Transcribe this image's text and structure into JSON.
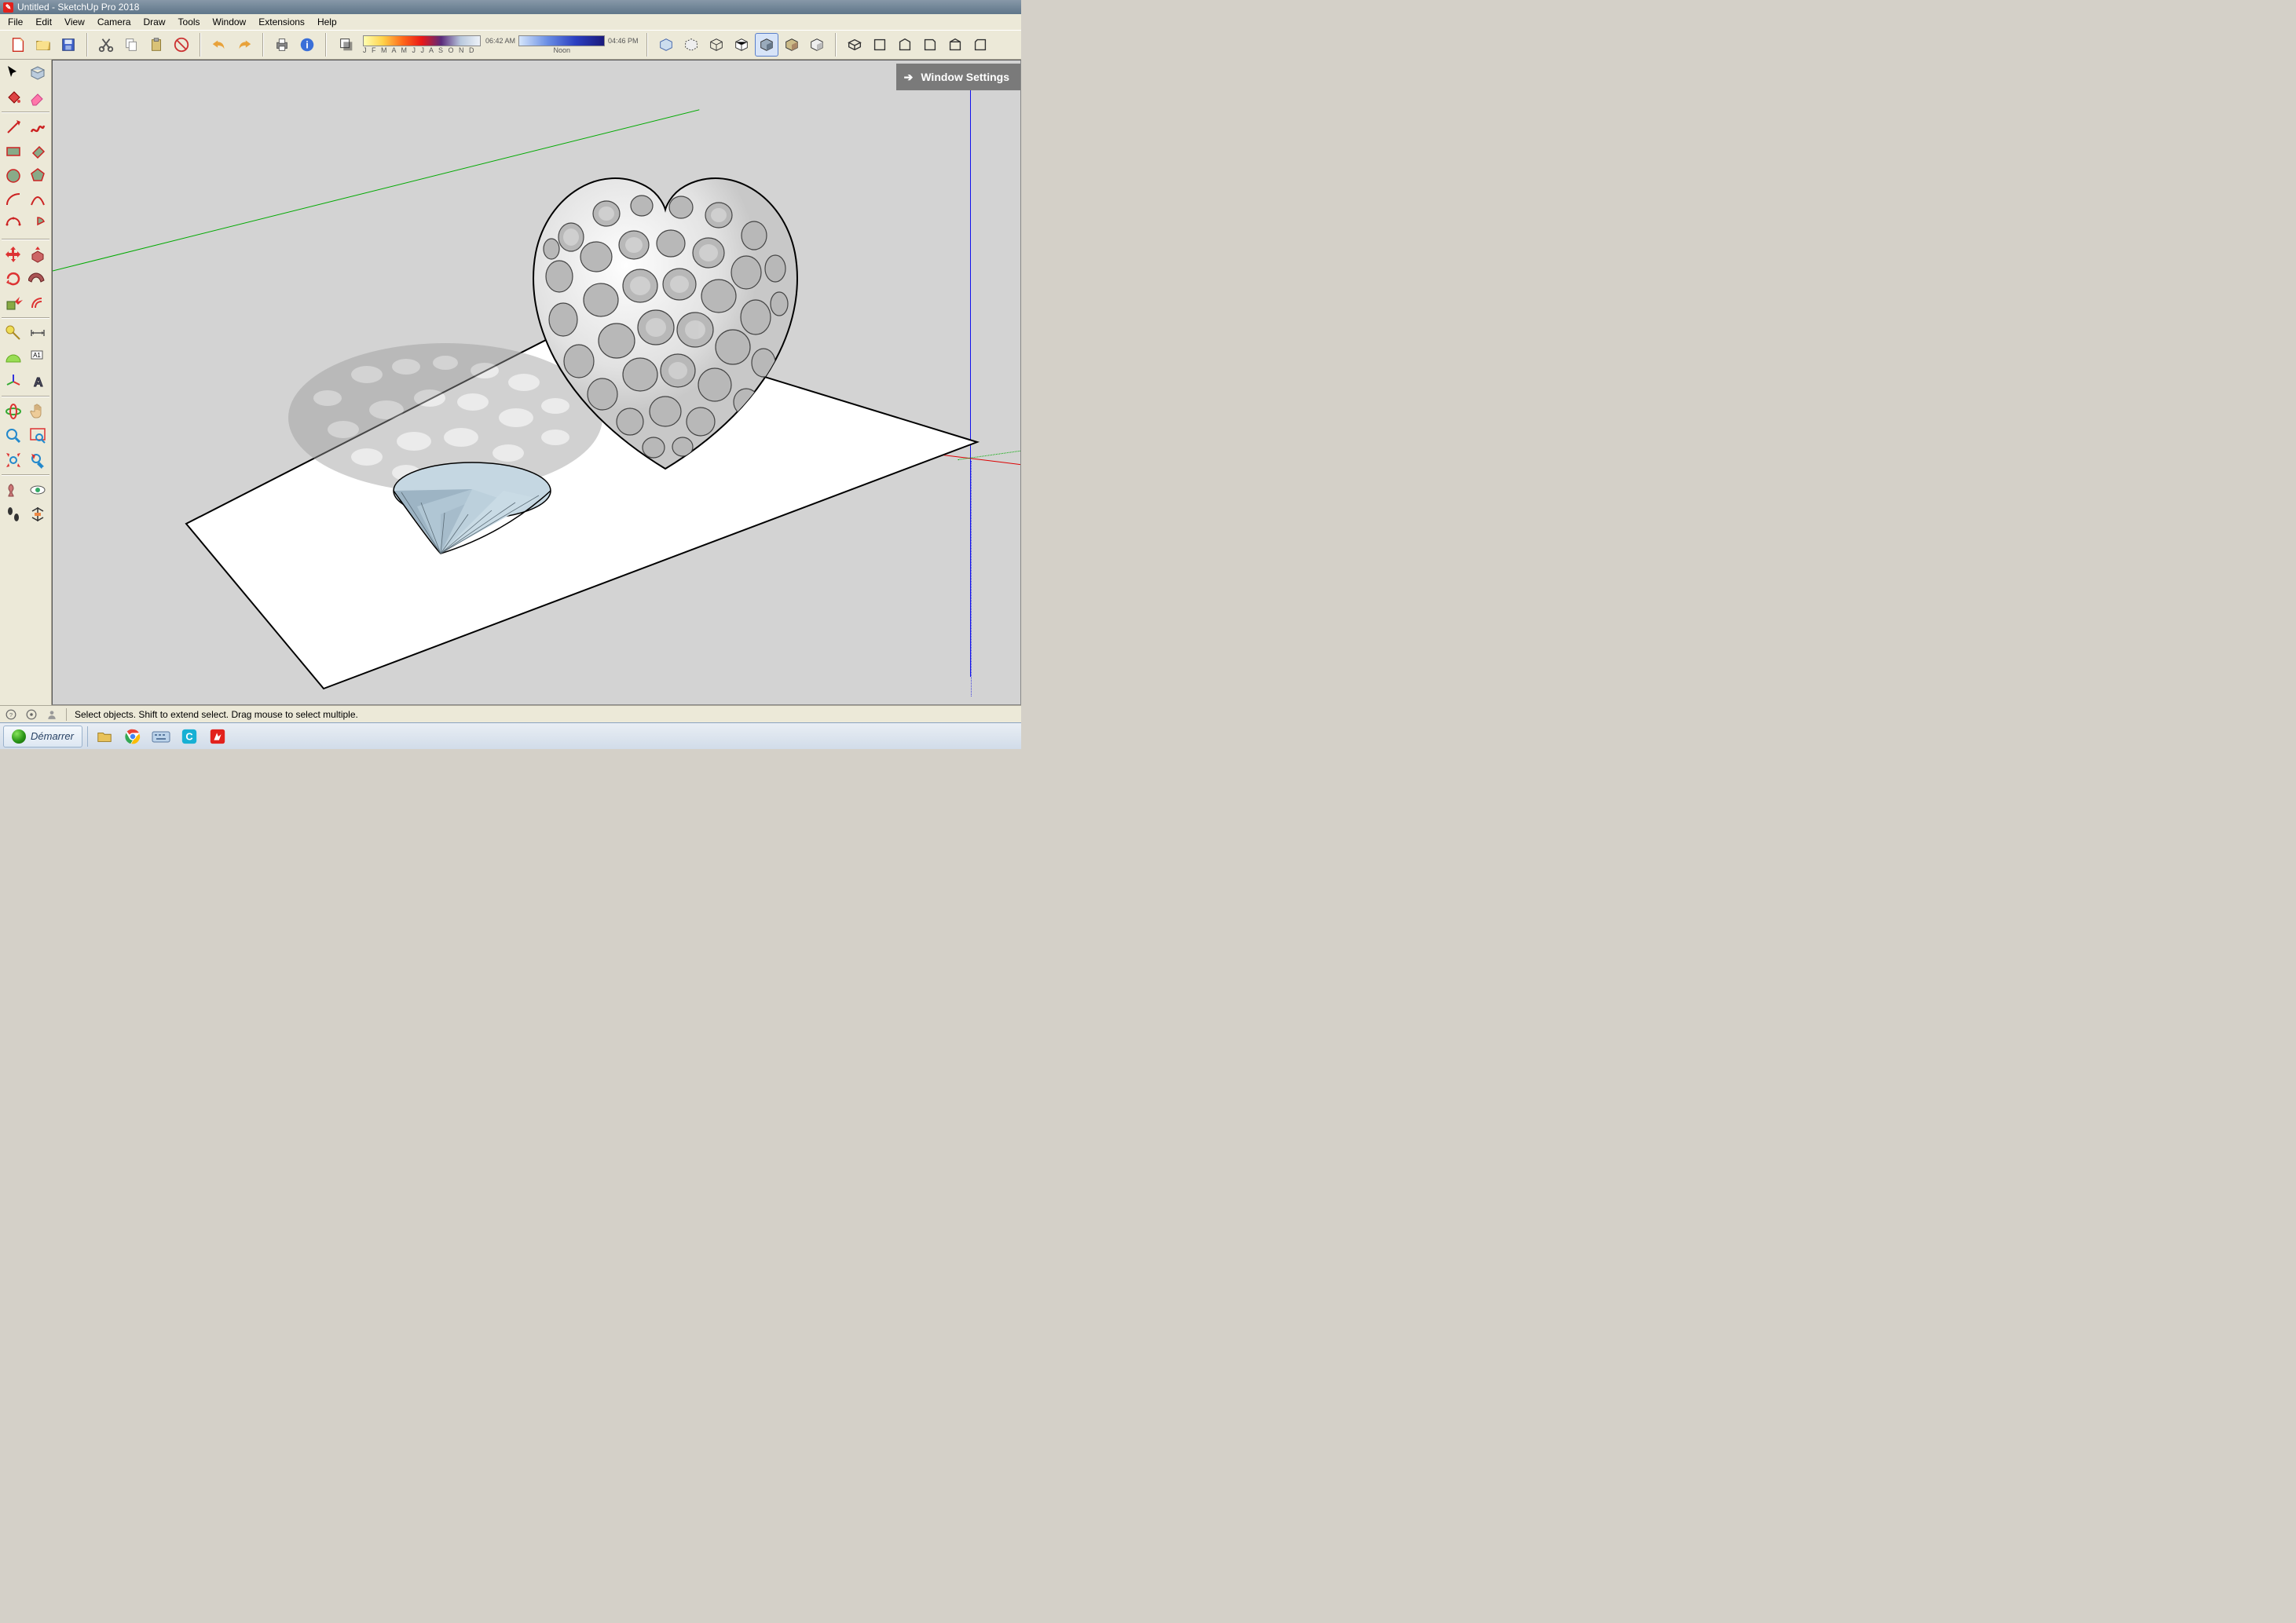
{
  "title": "Untitled - SketchUp Pro 2018",
  "menu": [
    "File",
    "Edit",
    "View",
    "Camera",
    "Draw",
    "Tools",
    "Window",
    "Extensions",
    "Help"
  ],
  "shadow": {
    "months": "J F M A M J J A S O N D",
    "morning": "06:42 AM",
    "noon": "Noon",
    "evening": "04:46 PM"
  },
  "window_settings": "Window Settings",
  "status": "Select objects. Shift to extend select. Drag mouse to select multiple.",
  "start": "Démarrer"
}
